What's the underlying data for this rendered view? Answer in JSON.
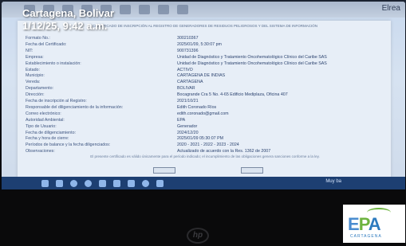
{
  "overlay": {
    "location": "Cartagena, Bolivar",
    "datetime": "1/12/25, 9:42 a.m."
  },
  "toolbar": {
    "right_label": "Elrea"
  },
  "document": {
    "title": "CERTIFICADO DE INSCRIPCIÓN AL REGISTRO DE GENERADORES DE RESIDUOS PELIGROSOS Y DEL SISTEMA DE INFORMACIÓN",
    "rows": [
      {
        "label": "Formato No.:",
        "value": "300210367"
      },
      {
        "label": "Fecha del Certificado:",
        "value": "2025/01/09, 5:30:07 pm"
      },
      {
        "label": "NIT:",
        "value": "900731396"
      },
      {
        "label": "Empresa:",
        "value": "Unidad de Diagnóstico y Tratamiento Oncohematológico Clínico del Caribe SAS"
      },
      {
        "label": "Establecimiento o instalación:",
        "value": "Unidad de Diagnóstico y Tratamiento Oncohematológico Clínico del Caribe SAS"
      },
      {
        "label": "Estado:",
        "value": "ACTIVO"
      },
      {
        "label": "Municipio:",
        "value": "CARTAGENA DE INDIAS"
      },
      {
        "label": "Vereda:",
        "value": "CARTAGENA"
      },
      {
        "label": "Departamento:",
        "value": "BOLIVAR"
      },
      {
        "label": "Dirección:",
        "value": "Bocagrande Cra 5 No. 4-65 Edificio Mediplaza, Oficina 407"
      },
      {
        "label": "Fecha de inscripción al Registro:",
        "value": "2021/10/21"
      },
      {
        "label": "Responsable del diligenciamiento de la información:",
        "value": "Edith Coronado Ríos"
      },
      {
        "label": "Correo electrónico:",
        "value": "edith.coronado@gmail.com"
      },
      {
        "label": "Autoridad Ambiental:",
        "value": "EPA"
      },
      {
        "label": "Tipo de Usuario:",
        "value": "Generador"
      },
      {
        "label": "Fecha de diligenciamiento:",
        "value": "2024/12/20"
      },
      {
        "label": "Fecha y hora de cierre:",
        "value": "2025/01/09 05:30:07 PM"
      },
      {
        "label": "Períodos de balance y la fecha diligenciados:",
        "value": "2020 - 2021 - 2022 - 2023 - 2024"
      },
      {
        "label": "Observaciones:",
        "value": "Actualizado de acuerdo con la Res. 1362 de 2007"
      }
    ],
    "footnote": "El presente certificado es válido únicamente para el período indicado; el incumplimiento de las obligaciones genera sanciones conforme a la ley."
  },
  "taskbar": {
    "tray_text": "Muy ba"
  },
  "brand": {
    "hp_logo": "hp",
    "epa_letters": [
      "E",
      "P",
      "A"
    ],
    "epa_sub": "CARTAGENA"
  },
  "colors": {
    "screen_bg": "#cfdbeb",
    "taskbar": "#1d3f72",
    "epa_blue": "#2e7bbf",
    "epa_green": "#6db33f"
  }
}
